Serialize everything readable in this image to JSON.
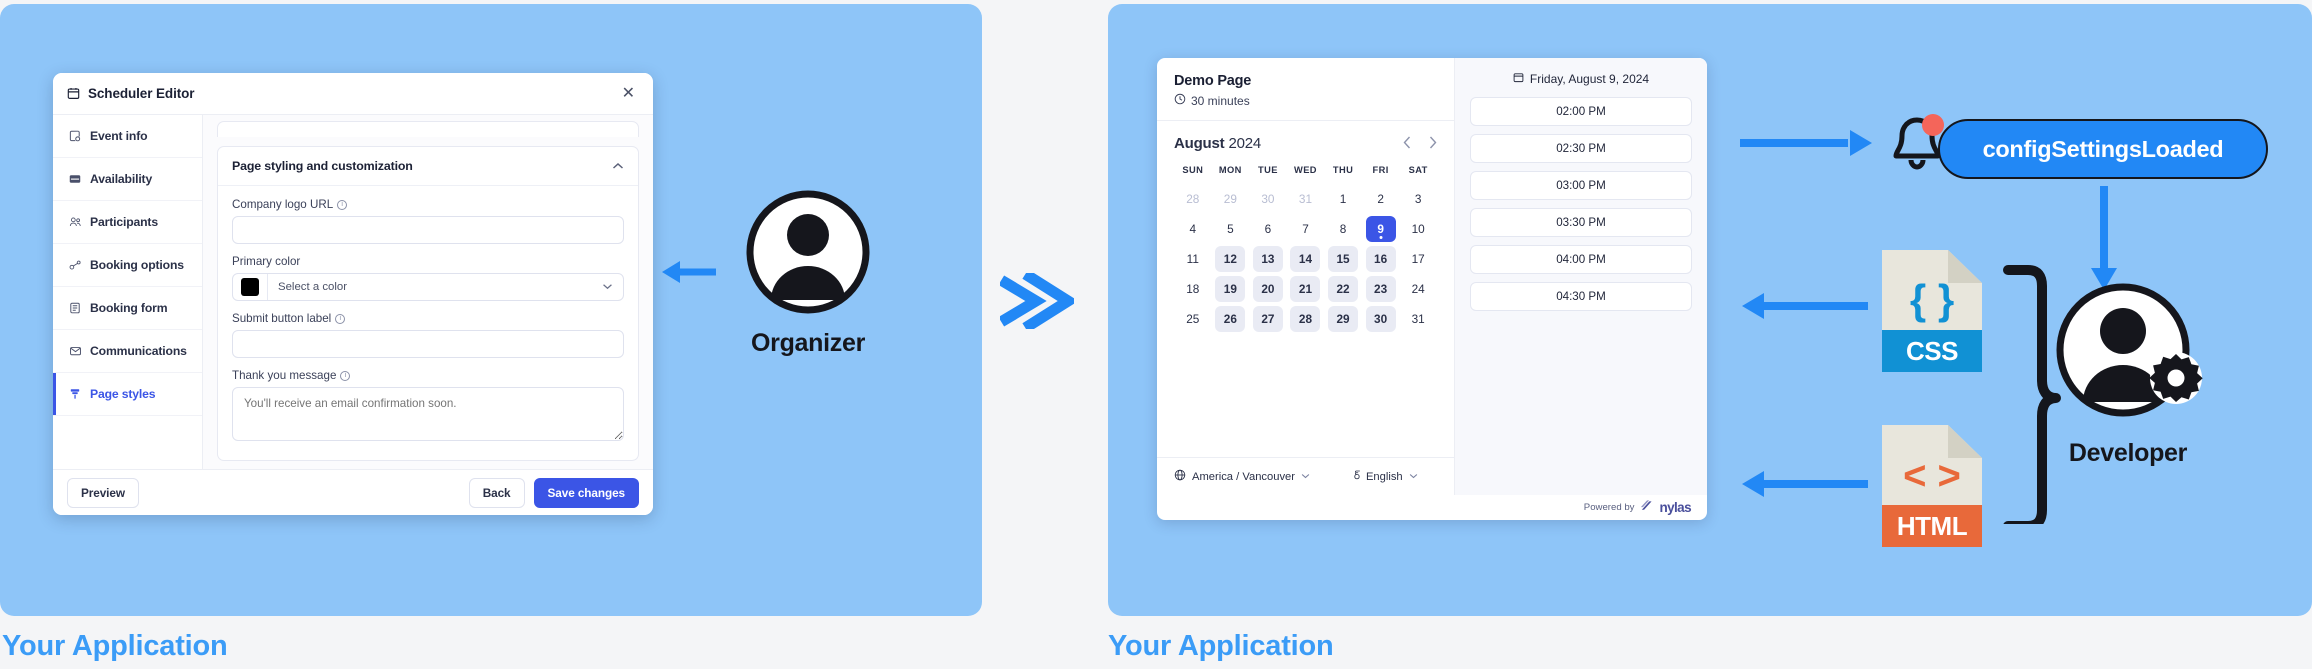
{
  "captions": {
    "left": "Your Application",
    "right": "Your Application"
  },
  "colors": {
    "panel_blue": "#8ec5f8",
    "caption_blue": "#3b9cf7",
    "accent_indigo": "#3b55e6",
    "chip_blue": "#2288f5",
    "css_blue": "#1191d4",
    "html_orange": "#e8693a",
    "bell_dot_red": "#f4655a",
    "swatch": "#000000"
  },
  "editor": {
    "title": "Scheduler Editor",
    "title_icon": "calendar-icon",
    "close_icon": "close-icon",
    "nav": [
      {
        "label": "Event info",
        "icon": "event-info-icon",
        "active": false
      },
      {
        "label": "Availability",
        "icon": "availability-icon",
        "active": false
      },
      {
        "label": "Participants",
        "icon": "participants-icon",
        "active": false
      },
      {
        "label": "Booking options",
        "icon": "booking-options-icon",
        "active": false
      },
      {
        "label": "Booking form",
        "icon": "booking-form-icon",
        "active": false
      },
      {
        "label": "Communications",
        "icon": "communications-icon",
        "active": false
      },
      {
        "label": "Page styles",
        "icon": "page-styles-icon",
        "active": true
      }
    ],
    "section": {
      "heading": "Page styling and customization",
      "collapse_icon": "chevron-up-icon"
    },
    "fields": {
      "company_logo_url": {
        "label": "Company logo URL",
        "value": "",
        "placeholder": ""
      },
      "primary_color": {
        "label": "Primary color",
        "value": "Select a color",
        "swatch": "#000000"
      },
      "submit_button_label": {
        "label": "Submit button label",
        "value": "",
        "placeholder": ""
      },
      "thank_you_message": {
        "label": "Thank you message",
        "value": "",
        "placeholder": "You'll receive an email confirmation soon."
      }
    },
    "footer": {
      "preview": "Preview",
      "back": "Back",
      "save": "Save changes"
    }
  },
  "organizer": {
    "label": "Organizer",
    "icon": "user-avatar-icon"
  },
  "developer": {
    "label": "Developer",
    "icon": "user-avatar-gear-icon"
  },
  "booking": {
    "title": "Demo Page",
    "duration": "30 minutes",
    "duration_icon": "clock-icon",
    "calendar": {
      "month": "August",
      "year": "2024",
      "prev_icon": "chevron-left-icon",
      "next_icon": "chevron-right-icon",
      "weekdays": [
        "SUN",
        "MON",
        "TUE",
        "WED",
        "THU",
        "FRI",
        "SAT"
      ],
      "weeks": [
        [
          {
            "d": "28",
            "state": "muted"
          },
          {
            "d": "29",
            "state": "muted"
          },
          {
            "d": "30",
            "state": "muted"
          },
          {
            "d": "31",
            "state": "muted"
          },
          {
            "d": "1",
            "state": "plain"
          },
          {
            "d": "2",
            "state": "plain"
          },
          {
            "d": "3",
            "state": "plain"
          }
        ],
        [
          {
            "d": "4",
            "state": "plain"
          },
          {
            "d": "5",
            "state": "plain"
          },
          {
            "d": "6",
            "state": "plain"
          },
          {
            "d": "7",
            "state": "plain"
          },
          {
            "d": "8",
            "state": "plain"
          },
          {
            "d": "9",
            "state": "sel"
          },
          {
            "d": "10",
            "state": "plain"
          }
        ],
        [
          {
            "d": "11",
            "state": "plain"
          },
          {
            "d": "12",
            "state": "avail"
          },
          {
            "d": "13",
            "state": "avail"
          },
          {
            "d": "14",
            "state": "avail"
          },
          {
            "d": "15",
            "state": "avail"
          },
          {
            "d": "16",
            "state": "avail"
          },
          {
            "d": "17",
            "state": "plain"
          }
        ],
        [
          {
            "d": "18",
            "state": "plain"
          },
          {
            "d": "19",
            "state": "avail"
          },
          {
            "d": "20",
            "state": "avail"
          },
          {
            "d": "21",
            "state": "avail"
          },
          {
            "d": "22",
            "state": "avail"
          },
          {
            "d": "23",
            "state": "avail"
          },
          {
            "d": "24",
            "state": "plain"
          }
        ],
        [
          {
            "d": "25",
            "state": "plain"
          },
          {
            "d": "26",
            "state": "avail"
          },
          {
            "d": "27",
            "state": "avail"
          },
          {
            "d": "28",
            "state": "avail"
          },
          {
            "d": "29",
            "state": "avail"
          },
          {
            "d": "30",
            "state": "avail"
          },
          {
            "d": "31",
            "state": "plain"
          }
        ]
      ]
    },
    "timezone": {
      "label": "America / Vancouver",
      "icon": "globe-icon"
    },
    "language": {
      "label": "English",
      "icon": "language-icon"
    },
    "slots_header": {
      "label": "Friday, August 9, 2024",
      "icon": "calendar-icon"
    },
    "slots": [
      "02:00 PM",
      "02:30 PM",
      "03:00 PM",
      "03:30 PM",
      "04:00 PM",
      "04:30 PM"
    ],
    "powered_by": {
      "prefix": "Powered by",
      "brand": "nylas"
    }
  },
  "event_chip": {
    "label": "configSettingsLoaded",
    "bell_icon": "bell-notification-icon"
  },
  "files": [
    {
      "name": "CSS",
      "glyph": "{ }",
      "icon": "css-file-icon"
    },
    {
      "name": "HTML",
      "glyph": "< >",
      "icon": "html-file-icon"
    }
  ]
}
